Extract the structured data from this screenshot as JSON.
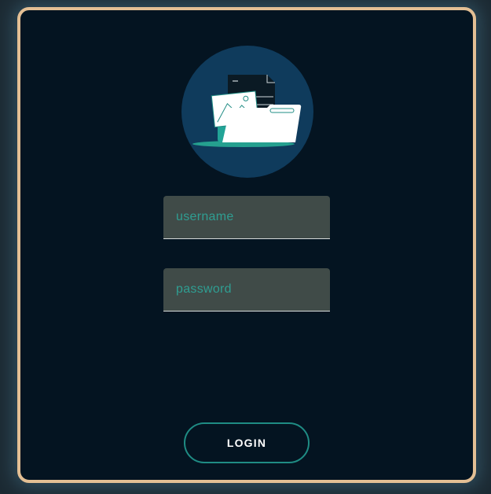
{
  "login_form": {
    "illustration_icon": "folder-with-documents-icon",
    "username": {
      "placeholder": "username",
      "value": ""
    },
    "password": {
      "placeholder": "password",
      "value": ""
    },
    "login_label": "LOGIN"
  },
  "colors": {
    "card_background": "#041421",
    "card_border": "#e3bf94",
    "field_background": "#404b48",
    "placeholder_accent": "#2f9e92",
    "button_border": "#1f8c84",
    "illustration_circle": "#0f3b5c"
  }
}
